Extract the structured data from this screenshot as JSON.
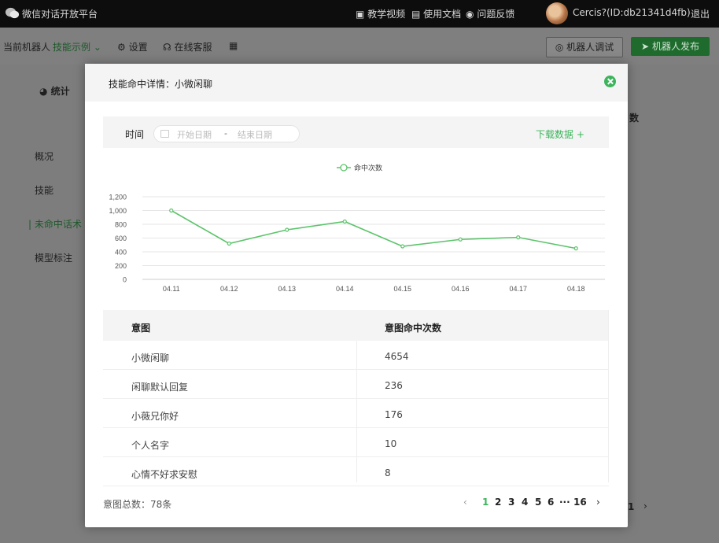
{
  "topbar": {
    "brand": "微信对话开放平台",
    "links": [
      "教学视频",
      "使用文档",
      "问题反馈"
    ],
    "user": "Cercis?(ID:db21341d4fb)",
    "logout": "退出"
  },
  "subbar": {
    "bot_label": "当前机器人",
    "bot_name": "技能示例",
    "settings": "设置",
    "support": "在线客服",
    "debug_button": "机器人调试",
    "publish_button": "机器人发布"
  },
  "background": {
    "stats": "统计",
    "nav": [
      "概况",
      "技能",
      "未命中话术",
      "模型标注"
    ],
    "col_header_fragment": "数",
    "page_fragment": "1"
  },
  "modal": {
    "title": "技能命中详情：小微闲聊",
    "filter": {
      "label": "时间",
      "start_placeholder": "开始日期",
      "separator": "-",
      "end_placeholder": "结束日期",
      "download": "下载数据 +"
    },
    "table": {
      "headers": [
        "意图",
        "意图命中次数"
      ],
      "rows": [
        {
          "intent": "小微闲聊",
          "count": "4654"
        },
        {
          "intent": "闲聊默认回复",
          "count": "236"
        },
        {
          "intent": "小薇兄你好",
          "count": "176"
        },
        {
          "intent": "个人名字",
          "count": "10"
        },
        {
          "intent": "心情不好求安慰",
          "count": "8"
        }
      ]
    },
    "total": "意图总数：78条",
    "pagination": {
      "pages": [
        "1",
        "2",
        "3",
        "4",
        "5",
        "6"
      ],
      "ellipsis": "···",
      "last": "16",
      "current": "1",
      "prev": "‹",
      "next": "›"
    }
  },
  "chart_data": {
    "type": "line",
    "x": [
      "04.11",
      "04.12",
      "04.13",
      "04.14",
      "04.15",
      "04.16",
      "04.17",
      "04.18"
    ],
    "series": [
      {
        "name": "命中次数",
        "values": [
          1000,
          520,
          720,
          840,
          480,
          580,
          610,
          450
        ],
        "color": "#5cc46b"
      }
    ],
    "ylim": [
      0,
      1200
    ],
    "yticks": [
      "0",
      "200",
      "400",
      "600",
      "800",
      "1,000",
      "1,200"
    ],
    "grid": true,
    "legend": "top-center"
  },
  "colors": {
    "accent": "#3cb45b",
    "topbar": "#0d0d0d"
  }
}
